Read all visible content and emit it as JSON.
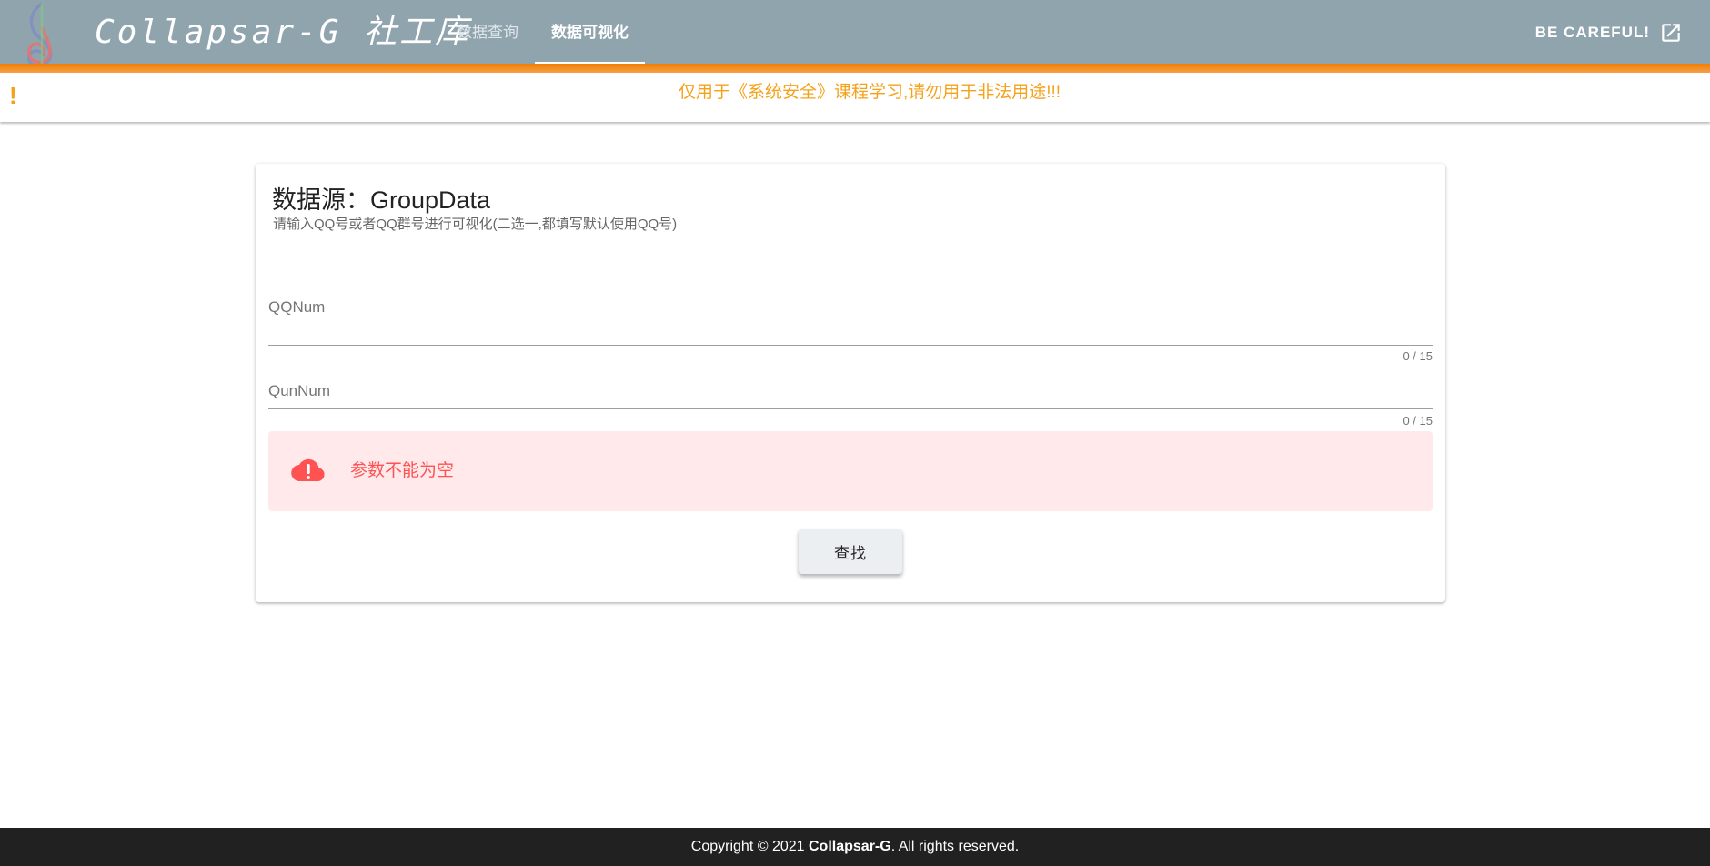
{
  "header": {
    "brand": "Collapsar-G 社工库",
    "tabs": [
      {
        "label": "数据查询",
        "active": false
      },
      {
        "label": "数据可视化",
        "active": true
      }
    ],
    "careful_label": "BE CAREFUL!"
  },
  "banner": {
    "mark": "!",
    "text": "仅用于《系统安全》课程学习,请勿用于非法用途!!!"
  },
  "card": {
    "title": "数据源：GroupData",
    "subtitle": "请输入QQ号或者QQ群号进行可视化(二选一,都填写默认使用QQ号)",
    "fields": [
      {
        "label": "QQNum",
        "value": "",
        "counter": "0 / 15"
      },
      {
        "label": "QunNum",
        "value": "",
        "counter": "0 / 15"
      }
    ],
    "alert": {
      "text": "参数不能为空"
    },
    "search_button": "查找"
  },
  "footer": {
    "prefix": "Copyright © 2021 ",
    "owner": "Collapsar-G",
    "suffix": ". All rights reserved."
  },
  "colors": {
    "header_bg": "#90a4ae",
    "accent": "#f57c00",
    "warning_text": "#f5a21b",
    "error_text": "#ff5252",
    "error_bg": "#ffe9ea",
    "footer_bg": "#212121"
  },
  "icons": {
    "logo": "treble-clef-icon",
    "external": "open-in-new-icon",
    "alert": "cloud-alert-icon"
  }
}
